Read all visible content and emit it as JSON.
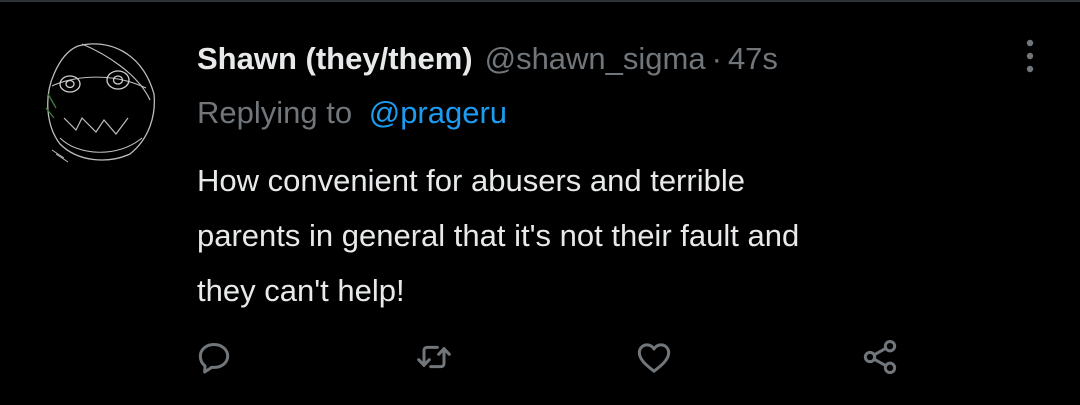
{
  "tweet": {
    "display_name": "Shawn (they/them)",
    "handle": "@shawn_sigma",
    "separator": "·",
    "timestamp": "47s",
    "replying_label": "Replying to",
    "replying_to": "@prageru",
    "text_lines": [
      "How convenient for abusers and terrible",
      "parents in general that it's not their fault and",
      "they can't help!"
    ]
  },
  "actions": {
    "reply_icon": "reply-icon",
    "retweet_icon": "retweet-icon",
    "like_icon": "heart-icon",
    "share_icon": "share-icon",
    "more_icon": "more-vertical-icon"
  },
  "colors": {
    "background": "#000000",
    "primary_text": "#e7e9ea",
    "secondary_text": "#71767b",
    "accent": "#1d9bf0",
    "icon": "#71767b"
  }
}
